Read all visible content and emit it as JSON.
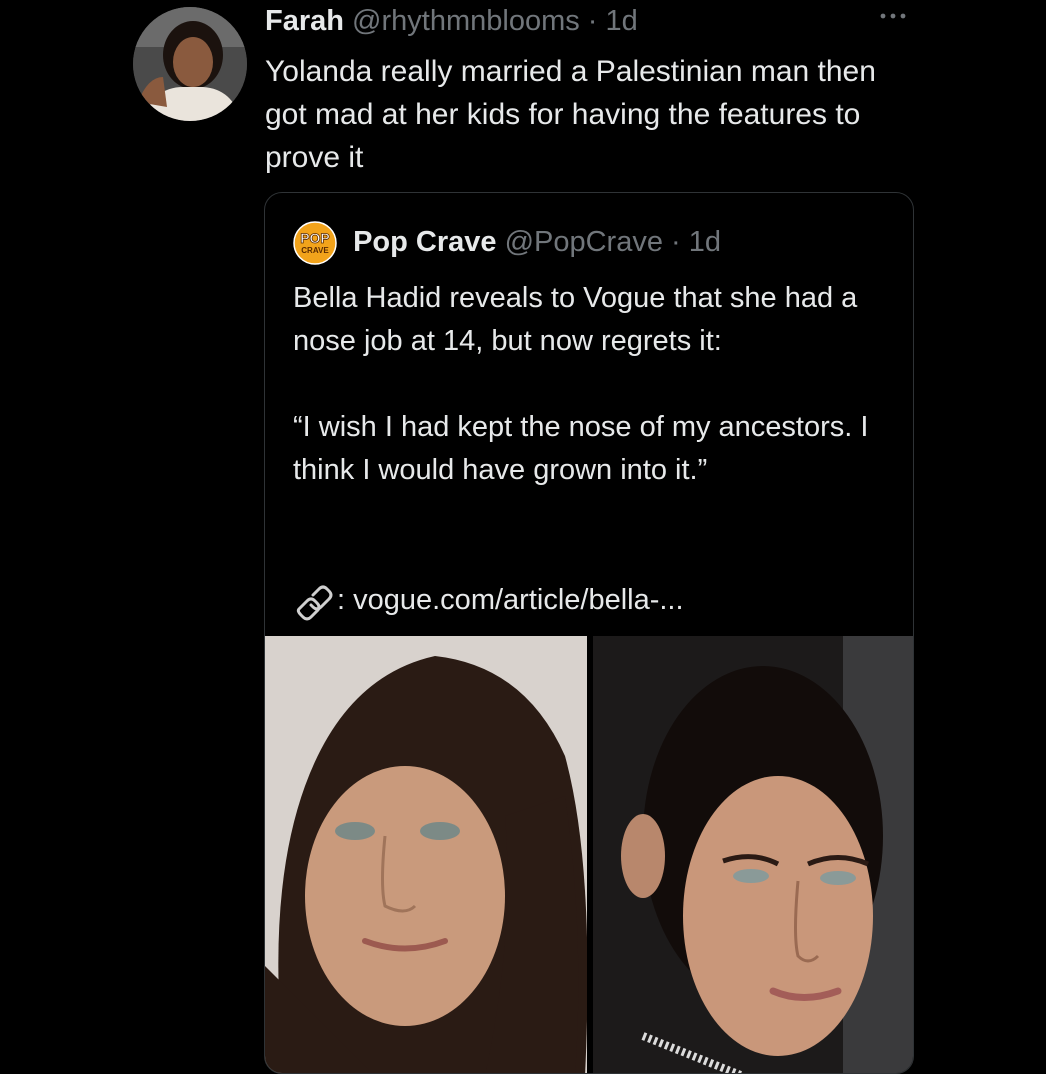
{
  "tweet": {
    "author_name": "Farah",
    "author_handle": "@rhythmnblooms",
    "separator": "·",
    "time": "1d",
    "more_icon": "more-horizontal-icon",
    "text": "Yolanda really married a Palestinian man then got mad at her kids for having the features to prove it"
  },
  "quoted_tweet": {
    "logo_text_top": "POP",
    "logo_text_bottom": "CRAVE",
    "author_name": "Pop Crave",
    "author_handle": "@PopCrave",
    "separator": "·",
    "time": "1d",
    "text": "Bella Hadid reveals to Vogue that she had a nose job at 14, but now regrets it:\n\n“I wish I had kept the nose of my ancestors. I think I would have grown into it.”",
    "link_icon": "link-icon",
    "link_text": ": vogue.com/article/bella-..."
  },
  "colors": {
    "background": "#000000",
    "text_primary": "#e7e9ea",
    "text_secondary": "#71767b",
    "border": "#2f3336",
    "pop_crave_orange": "#f2a31b"
  }
}
